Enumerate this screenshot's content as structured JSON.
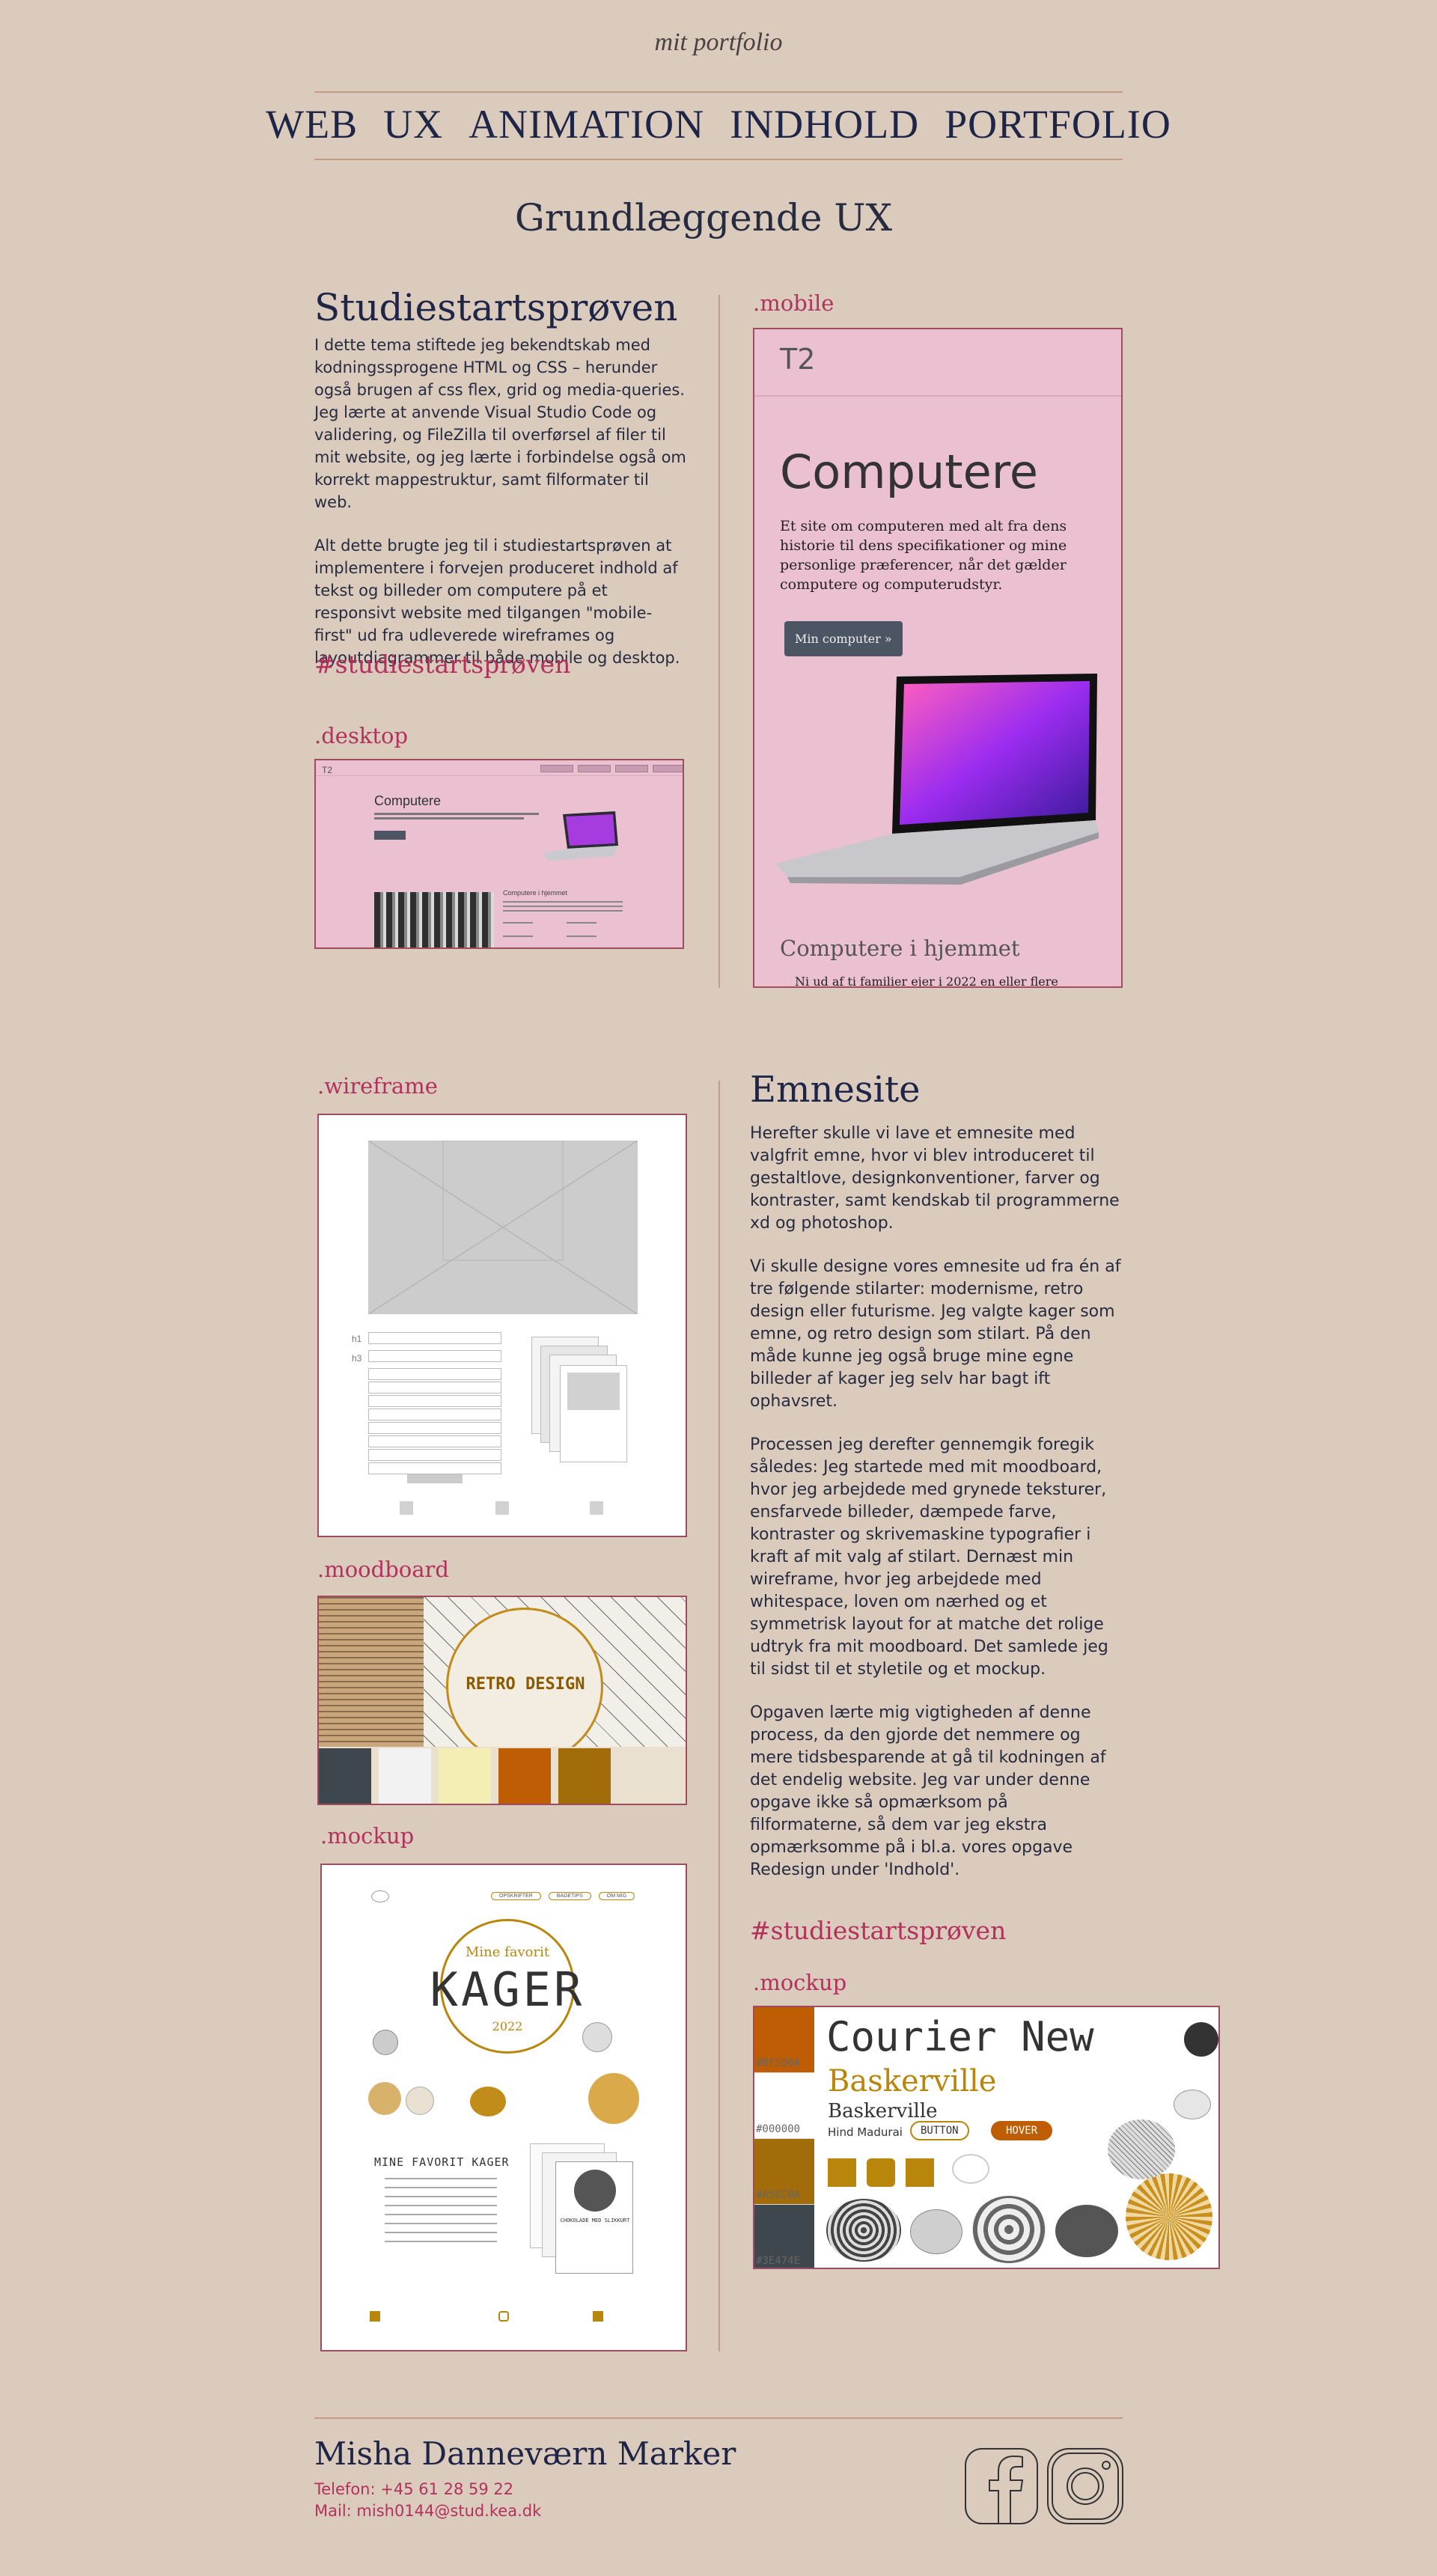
{
  "header": {
    "brand": "mit portfolio",
    "nav": [
      "WEB",
      "UX",
      "ANIMATION",
      "INDHOLD",
      "PORTFOLIO"
    ]
  },
  "section_title": "Grundlæggende UX",
  "studiestart": {
    "heading": "Studiestartsprøven",
    "paragraphs": [
      "I dette tema stiftede jeg bekendtskab med kodningssprogene HTML og CSS – herunder også brugen af css flex, grid og media-queries. Jeg lærte at anvende Visual Studio Code og validering, og FileZilla til overførsel af filer til mit website, og jeg lærte i forbindelse også om korrekt mappestruktur, samt filformater til web.",
      "Alt dette brugte jeg til i studiestartsprøven at implementere i forvejen produceret indhold af tekst og billeder om computere på et responsivt website med tilgangen \"mobile-first\" ud fra udleverede wireframes og layoutdiagrammer til både mobile og desktop."
    ],
    "hashtag": "#studiestartsprøven",
    "desktop_label": ".desktop",
    "mobile_label": ".mobile",
    "desktop_mock": {
      "logo": "T2",
      "title": "Computere",
      "subheading": "Computere i hjemmet"
    },
    "mobile_mock": {
      "logo": "T2",
      "title": "Computere",
      "text": "Et site om computeren med alt fra dens historie til dens specifikationer og mine personlige præferencer, når det gælder computere og computerudstyr.",
      "button": "Min computer »",
      "subheading": "Computere i hjemmet",
      "subtext": "Ni ud af ti familier ejer i 2022 en eller flere"
    }
  },
  "emnesite": {
    "heading": "Emnesite",
    "paragraphs": [
      "Herefter skulle vi lave et emnesite med valgfrit emne, hvor vi blev introduceret til gestaltlove, designkonventioner, farver og kontraster, samt kendskab til programmerne xd og photoshop.",
      "Vi skulle designe vores emnesite ud fra én af tre følgende stilarter: modernisme, retro design eller futurisme. Jeg valgte kager som emne, og retro design som stilart. På den måde kunne jeg også bruge mine egne billeder af kager jeg selv har bagt ift ophavsret.",
      "Processen jeg derefter gennemgik foregik således: Jeg startede med mit moodboard, hvor jeg arbejdede med grynede teksturer, ensfarvede billeder, dæmpede farve, kontraster og skrivemaskine typografier i kraft af mit valg af stilart. Dernæst min wireframe, hvor jeg arbejdede med whitespace, loven om nærhed og et symmetrisk layout for at matche det rolige udtryk fra mit moodboard. Det samlede jeg til sidst til et styletile og et mockup.",
      "Opgaven lærte mig vigtigheden af denne process, da den gjorde det nemmere og mere tidsbesparende at gå til kodningen af det endelig website. Jeg var under denne opgave ikke så opmærksom på filformaterne, så dem var jeg ekstra opmærksomme på i bl.a. vores opgave Redesign under 'Indhold'."
    ],
    "hashtag": "#studiestartsprøven",
    "wireframe_label": ".wireframe",
    "wireframe": {
      "h1": "h1",
      "h3": "h3"
    },
    "moodboard_label": ".moodboard",
    "moodboard": {
      "title": "RETRO DESIGN",
      "swatches": [
        "#3e474e",
        "#f2f2f2",
        "#f4eeb4",
        "#bf5d04",
        "#a26c0a"
      ]
    },
    "mockup_label": ".mockup",
    "mockup_left": {
      "nav": [
        "OPSKRIFTER",
        "BAGETIPS",
        "OM MIG"
      ],
      "subtitle": "Mine favorit",
      "title": "KAGER",
      "year": "2022",
      "section": "MINE FAVORIT KAGER",
      "card": "CHOKOLADE MED SLIKKURT"
    },
    "mockup2_label": ".mockup",
    "styletile": {
      "swatches": [
        {
          "hex": "#BF5D04",
          "color": "#bf5d04"
        },
        {
          "hex": "#000000",
          "color": "#ffffff"
        },
        {
          "hex": "#A56C0A",
          "color": "#a26c0a"
        },
        {
          "hex": "#3E474E",
          "color": "#3e474e"
        }
      ],
      "font1": "Courier New",
      "font2": "Baskerville",
      "font3": "Baskerville",
      "font4": "Hind Madurai",
      "button": "BUTTON",
      "hover": "HOVER"
    }
  },
  "footer": {
    "name": "Misha Danneværn Marker",
    "phone_label": "Telefon:",
    "phone": "+45 61 28 59 22",
    "mail_label": "Mail:",
    "mail": "mish0144@stud.kea.dk"
  }
}
